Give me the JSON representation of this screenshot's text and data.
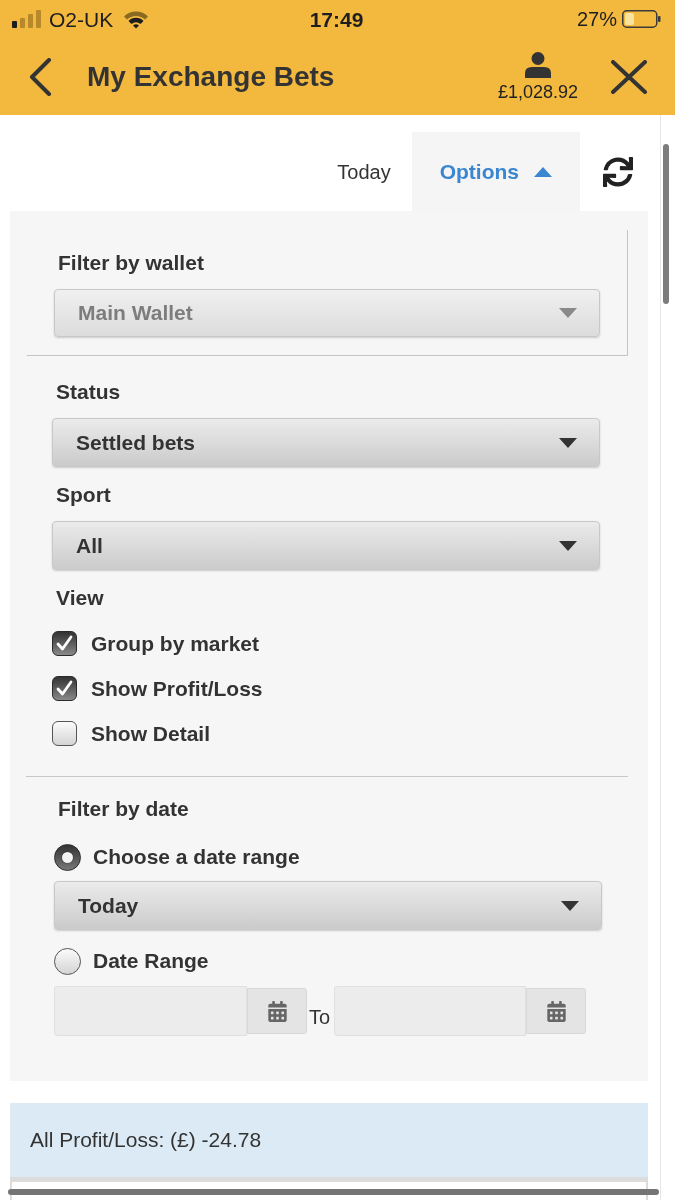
{
  "status_bar": {
    "carrier": "O2-UK",
    "time": "17:49",
    "battery": "27%"
  },
  "header": {
    "title": "My Exchange Bets",
    "balance": "£1,028.92"
  },
  "tabs": [
    {
      "label": "Today",
      "kind": "plain",
      "selected": false
    },
    {
      "label": "Options",
      "kind": "dropdown",
      "selected": true,
      "expanded": true
    }
  ],
  "wallet": {
    "label": "Filter by wallet",
    "value": "Main Wallet",
    "disabled": true
  },
  "filters": [
    {
      "label": "Status",
      "value": "Settled bets",
      "disabled": false
    },
    {
      "label": "Sport",
      "value": "All",
      "disabled": false
    }
  ],
  "view": {
    "label": "View",
    "options": [
      {
        "label": "Group by market",
        "checked": true
      },
      {
        "label": "Show Profit/Loss",
        "checked": true
      },
      {
        "label": "Show Detail",
        "checked": false
      }
    ]
  },
  "date_filter": {
    "label": "Filter by date",
    "options": [
      {
        "label": "Choose a date range",
        "kind": "preset",
        "selected": true,
        "value": "Today"
      },
      {
        "label": "Date Range",
        "kind": "range",
        "selected": false,
        "separator": "To"
      }
    ]
  },
  "summary": "All Profit/Loss: (£) -24.78"
}
